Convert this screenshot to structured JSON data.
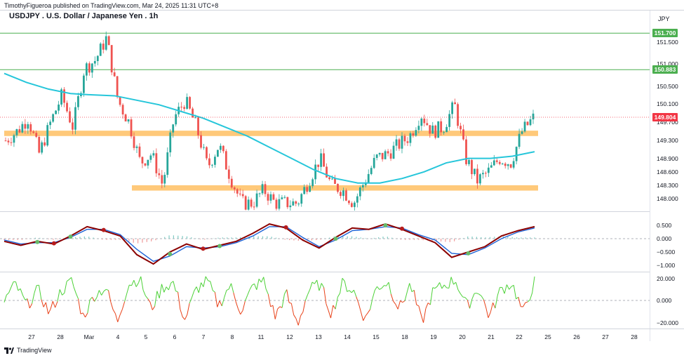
{
  "header": {
    "published_line": "TimothyFigueroa published on TradingView.com, Mar 24, 2025 11:31 UTC+8",
    "symbol_title": "USDJPY . U.S. Dollar / Japanese Yen . 1h",
    "currency": "JPY"
  },
  "footer": {
    "brand": "TradingView",
    "logo_icon": "tradingview-logo-icon"
  },
  "colors": {
    "up": "#26a69a",
    "down": "#ef5350",
    "sma": "#26c6da",
    "zone": "#ffb74d",
    "level_line": "#4caf50",
    "current_tag": "#f23645",
    "macd_fast": "#8b0000",
    "macd_slow": "#1e63d6",
    "cross_up": "#66bb6a",
    "cross_down": "#b71c1c",
    "osc_up": "#4cd137",
    "osc_down": "#e84118"
  },
  "price_axis": {
    "ticks": [
      "151.500",
      "151.000",
      "150.500",
      "150.100",
      "149.700",
      "149.300",
      "148.900",
      "148.600",
      "148.300",
      "148.000"
    ],
    "tags": [
      {
        "label": "151.700",
        "color": "#4caf50"
      },
      {
        "label": "150.883",
        "color": "#4caf50"
      },
      {
        "label": "149.804",
        "color": "#f23645"
      }
    ]
  },
  "macd_axis": {
    "ticks": [
      "0.500",
      "0.000",
      "−0.500",
      "−1.000"
    ]
  },
  "osc_axis": {
    "ticks": [
      "20.000",
      "0.000",
      "−20.000"
    ]
  },
  "time_axis": {
    "labels": [
      "27",
      "28",
      "Mar",
      "4",
      "5",
      "6",
      "7",
      "8",
      "11",
      "12",
      "13",
      "14",
      "15",
      "18",
      "19",
      "20",
      "21",
      "22",
      "25",
      "26",
      "27",
      "28"
    ]
  },
  "chart_data": {
    "type": "candlestick",
    "symbol": "USDJPY",
    "interval": "1h",
    "horizontal_levels": [
      151.7,
      150.883
    ],
    "last_price": 149.804,
    "support_resistance_zones": [
      {
        "low": 149.4,
        "high": 149.52
      },
      {
        "low": 148.18,
        "high": 148.3
      }
    ],
    "close_path": [
      149.3,
      149.5,
      149.8,
      149.0,
      149.7,
      150.3,
      149.6,
      150.9,
      151.1,
      151.6,
      150.2,
      149.7,
      148.8,
      149.0,
      148.3,
      149.8,
      150.2,
      149.6,
      148.7,
      149.2,
      148.5,
      147.9,
      147.9,
      148.2,
      147.9,
      147.9,
      147.9,
      148.4,
      148.9,
      148.3,
      148.2,
      147.9,
      148.4,
      148.9,
      149.0,
      149.2,
      149.4,
      149.9,
      149.5,
      149.6,
      150.1,
      148.9,
      148.4,
      148.6,
      148.9,
      148.8,
      149.5,
      149.8
    ],
    "moving_average": [
      150.8,
      150.6,
      150.45,
      150.35,
      150.32,
      150.3,
      150.2,
      150.1,
      149.95,
      149.8,
      149.6,
      149.4,
      149.15,
      148.9,
      148.65,
      148.45,
      148.35,
      148.35,
      148.45,
      148.6,
      148.8,
      148.9,
      148.9,
      148.95,
      149.05
    ],
    "macd": {
      "ylim": [
        -1.1,
        0.7
      ],
      "fast": [
        -0.1,
        -0.25,
        -0.1,
        -0.2,
        0.1,
        0.45,
        0.3,
        0.1,
        -0.6,
        -0.95,
        -0.5,
        -0.2,
        -0.4,
        -0.25,
        -0.1,
        0.2,
        0.55,
        0.4,
        -0.05,
        -0.35,
        0.05,
        0.4,
        0.35,
        0.55,
        0.35,
        0.1,
        -0.15,
        -0.7,
        -0.5,
        -0.3,
        0.1,
        0.3,
        0.45
      ],
      "slow": [
        -0.05,
        -0.2,
        -0.15,
        -0.15,
        0.05,
        0.35,
        0.35,
        0.15,
        -0.4,
        -0.85,
        -0.65,
        -0.3,
        -0.35,
        -0.3,
        -0.15,
        0.1,
        0.45,
        0.45,
        0.05,
        -0.3,
        -0.05,
        0.3,
        0.35,
        0.45,
        0.4,
        0.15,
        -0.05,
        -0.55,
        -0.6,
        -0.35,
        0.0,
        0.25,
        0.4
      ]
    },
    "oscillator": {
      "ylim": [
        -25,
        25
      ],
      "values": [
        0,
        15,
        -5,
        10,
        -12,
        8,
        18,
        -15,
        5,
        12,
        -20,
        15,
        20,
        -8,
        12,
        16,
        -18,
        10,
        18,
        -5,
        14,
        -10,
        12,
        18,
        -15,
        6,
        -22,
        10,
        15,
        -12,
        16,
        8,
        -18,
        12,
        17,
        -8,
        15,
        -20,
        8,
        14,
        19,
        -6,
        12,
        -15,
        10,
        16,
        -12,
        18
      ]
    }
  }
}
